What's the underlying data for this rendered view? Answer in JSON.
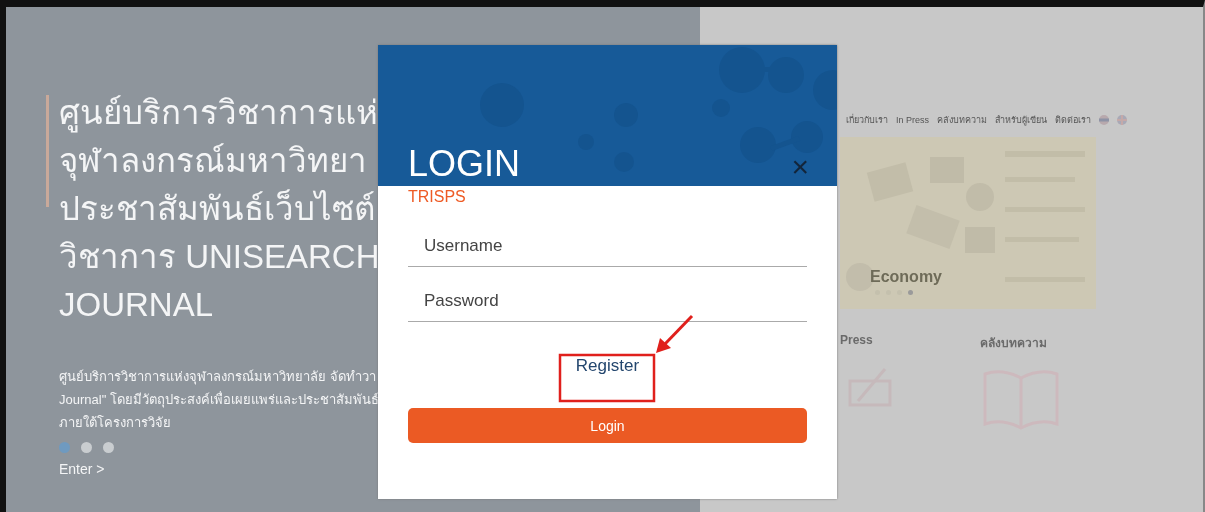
{
  "hero": {
    "headline": [
      "ศูนย์บริการวิชาการแห่",
      "จุฬาลงกรณ์มหาวิทยา",
      "ประชาสัมพันธ์เว็บไซต์",
      "วิชาการ UNISEARCH",
      "JOURNAL"
    ],
    "paragraph": [
      "ศูนย์บริการวิชาการแห่งจุฬาลงกรณ์มหาวิทยาลัย จัดทำวา",
      "Journal\" โดยมีวัตถุประสงค์เพื่อเผยแพร่และประชาสัมพันธ์",
      "ภายใต้โครงการวิจัย"
    ],
    "slides": [
      {
        "selected": true
      },
      {
        "selected": false
      },
      {
        "selected": false
      }
    ],
    "link": "Enter >"
  },
  "nav": {
    "items": [
      "เกี่ยวกับเรา",
      "In Press",
      "คลังบทความ",
      "สำหรับผู้เขียน",
      "ติดต่อเรา"
    ]
  },
  "banner": {
    "caption": "Economy",
    "slides": [
      {
        "selected": false
      },
      {
        "selected": false
      },
      {
        "selected": false
      },
      {
        "selected": true
      }
    ]
  },
  "sections": [
    {
      "title": "Press",
      "kind": "pencil"
    },
    {
      "title": "คลังบทความ",
      "kind": "book"
    }
  ],
  "dialog": {
    "title": "LOGIN",
    "subtitle": "TRISPS",
    "close": "×",
    "fields": [
      {
        "placeholder": "Username"
      },
      {
        "placeholder": "Password"
      }
    ],
    "register_link": "Register",
    "submit": "Login"
  }
}
